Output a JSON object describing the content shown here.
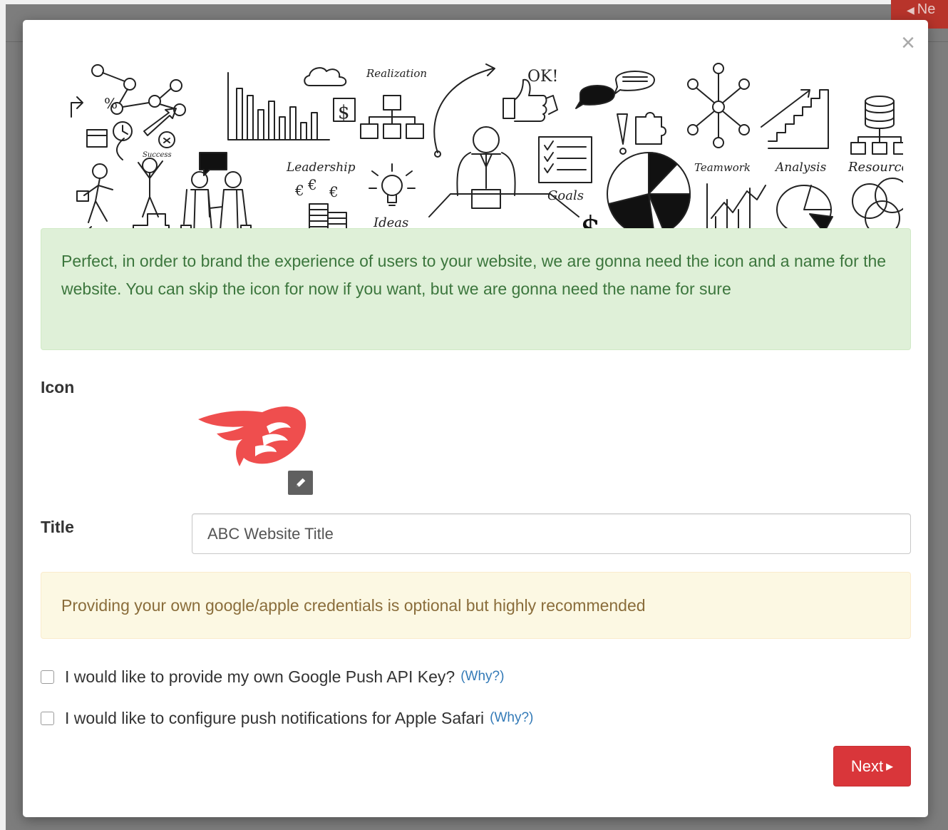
{
  "background": {
    "next_button_label": "Ne"
  },
  "modal": {
    "close_glyph": "×",
    "banner": {
      "labels": [
        "Realization",
        "OK!",
        "Success",
        "Leadership",
        "Ideas",
        "Goals",
        "Teamwork",
        "Analysis",
        "Resources"
      ]
    },
    "intro_alert": "Perfect, in order to brand the experience of users to your website, we are gonna need the icon and a name for the website. You can skip the icon for now if you want, but we are gonna need the name for sure",
    "icon_label": "Icon",
    "title_label": "Title",
    "title_value": "ABC Website Title",
    "warning_alert": "Providing your own google/apple credentials is optional but highly recommended",
    "options": [
      {
        "label": "I would like to provide my own Google Push API Key?",
        "link": "(Why?)",
        "checked": false
      },
      {
        "label": "I would like to configure push notifications for Apple Safari",
        "link": "(Why?)",
        "checked": false
      }
    ],
    "next_label": "Next",
    "next_caret": "▶"
  },
  "colors": {
    "success_bg": "#dff0d8",
    "success_text": "#3c763d",
    "warning_bg": "#fcf8e3",
    "warning_text": "#8a6d3b",
    "link": "#337ab7",
    "next_button": "#d9363a",
    "brand_icon": "#ef4e4e"
  }
}
